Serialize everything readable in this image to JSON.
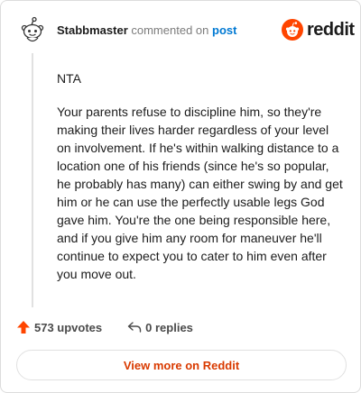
{
  "header": {
    "username": "Stabbmaster",
    "verb": "commented on",
    "post_link": "post"
  },
  "brand": {
    "wordmark": "reddit",
    "logo_icon": "reddit-snoo-icon",
    "color": "#ff4500"
  },
  "comment": {
    "paragraphs": [
      "NTA",
      "Your parents refuse to discipline him, so they're making their lives harder regardless of your level on involvement. If he's within walking distance to a location one of his friends (since he's so popular, he probably has many) can either swing by and get him or he can use the perfectly usable legs God gave him. You're the one being responsible here, and if you give him any room for maneuver he'll continue to expect you to cater to him even after you move out."
    ]
  },
  "actions": {
    "upvotes": "573 upvotes",
    "replies": "0 replies",
    "upvote_icon": "upvote-arrow-icon",
    "reply_icon": "reply-arrow-icon",
    "upvote_color": "#ff4500"
  },
  "footer": {
    "view_more": "View more on Reddit",
    "color": "#d93a00"
  }
}
